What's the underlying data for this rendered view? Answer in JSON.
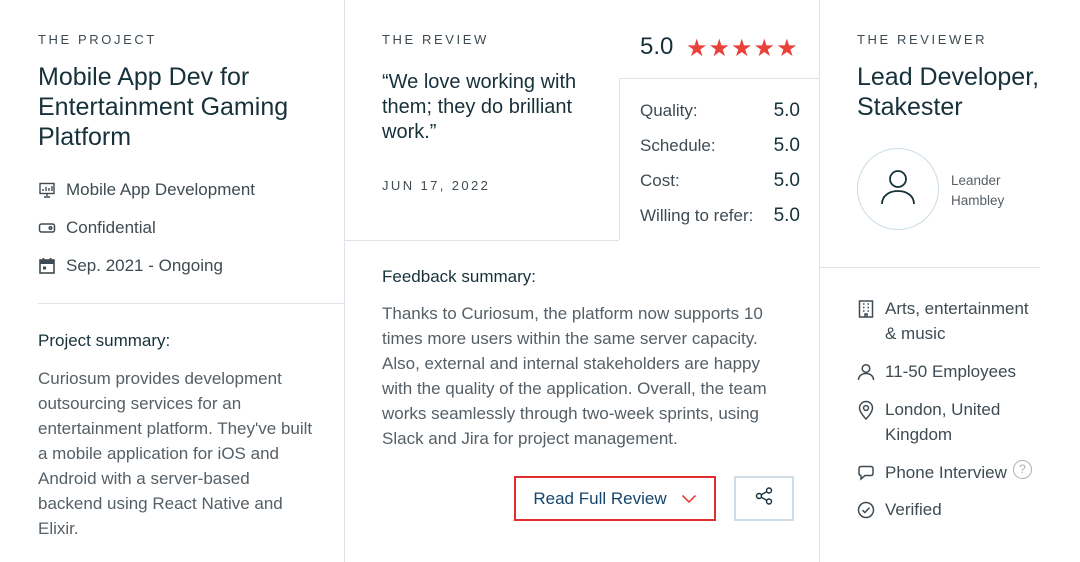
{
  "project": {
    "eyebrow": "THE PROJECT",
    "title": "Mobile App Dev for Entertainment Gaming Platform",
    "meta": [
      {
        "icon": "presentation-chart-icon",
        "text": "Mobile App Development"
      },
      {
        "icon": "price-tag-icon",
        "text": "Confidential"
      },
      {
        "icon": "calendar-icon",
        "text": "Sep. 2021 - Ongoing"
      }
    ],
    "summary_label": "Project summary:",
    "summary_text": "Curiosum provides development outsourcing services for an entertainment platform. They've built a mobile application for iOS and Android with a server-based backend using React Native and Elixir."
  },
  "review": {
    "eyebrow": "THE REVIEW",
    "quote": "“We love working with them; they do brilliant work.”",
    "date": "JUN 17, 2022",
    "overall": "5.0",
    "stars": 5,
    "star_color": "#e8423a",
    "ratings": [
      {
        "label": "Quality:",
        "value": "5.0"
      },
      {
        "label": "Schedule:",
        "value": "5.0"
      },
      {
        "label": "Cost:",
        "value": "5.0"
      },
      {
        "label": "Willing to refer:",
        "value": "5.0"
      }
    ],
    "feedback_label": "Feedback summary:",
    "feedback_text": "Thanks to Curiosum, the platform now supports 10 times more users within the same server capacity. Also, external and internal stakeholders are happy with the quality of the application. Overall, the team works seamlessly through two-week sprints, using Slack and Jira for project management.",
    "read_button": "Read Full Review",
    "highlight_color": "#e02f2f"
  },
  "reviewer": {
    "eyebrow": "THE REVIEWER",
    "title": "Lead Developer, Stakester",
    "name": "Leander Hambley",
    "info": [
      {
        "icon": "building-icon",
        "text": "Arts, entertainment & music"
      },
      {
        "icon": "person-icon",
        "text": "11-50 Employees"
      },
      {
        "icon": "location-pin-icon",
        "text": "London, United Kingdom"
      },
      {
        "icon": "chat-bubble-icon",
        "text": "Phone Interview"
      },
      {
        "icon": "check-circle-icon",
        "text": "Verified"
      }
    ],
    "help_glyph": "?"
  }
}
